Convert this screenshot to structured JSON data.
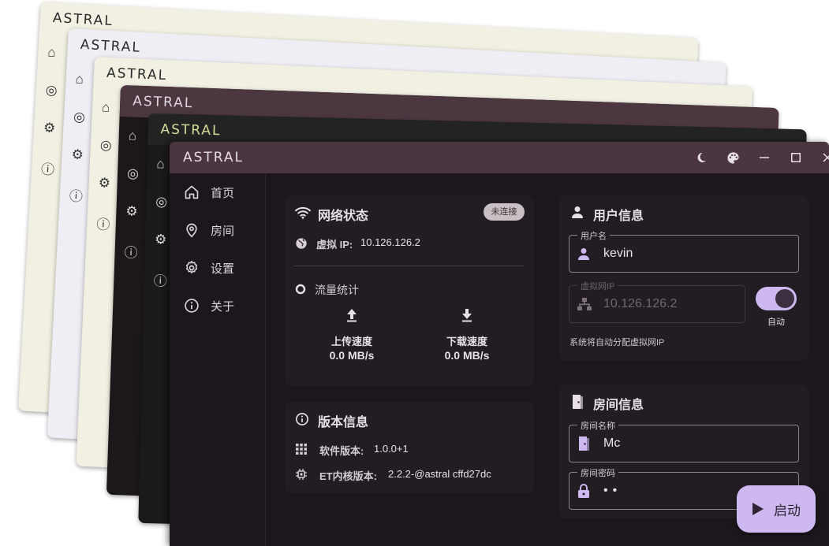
{
  "app_title": "ASTRAL",
  "nav": [
    {
      "label": "首页",
      "icon": "home-icon"
    },
    {
      "label": "房间",
      "icon": "location-pin-icon"
    },
    {
      "label": "设置",
      "icon": "gear-icon"
    },
    {
      "label": "关于",
      "icon": "info-icon"
    }
  ],
  "network": {
    "title": "网络状态",
    "status_badge": "未连接",
    "ip_label": "虚拟 IP:",
    "ip_value": "10.126.126.2"
  },
  "traffic": {
    "title": "流量统计",
    "upload_label": "上传速度",
    "upload_value": "0.0 MB/s",
    "download_label": "下载速度",
    "download_value": "0.0 MB/s"
  },
  "version": {
    "title": "版本信息",
    "software_label": "软件版本:",
    "software_value": "1.0.0+1",
    "core_label": "ET内核版本:",
    "core_value": "2.2.2-@astral cffd27dc"
  },
  "user": {
    "title": "用户信息",
    "username_label": "用户名",
    "username_value": "kevin",
    "vip_label": "虚拟网IP",
    "vip_value": "10.126.126.2",
    "auto_label": "自动",
    "auto_on": true,
    "hint": "系统将自动分配虚拟网IP"
  },
  "room": {
    "title": "房间信息",
    "name_label": "房间名称",
    "name_value": "Mc",
    "password_label": "房间密码",
    "password_value": "••"
  },
  "start_button": "启动",
  "colors": {
    "accent": "#cdb8f0",
    "titlebar": "#4a3540",
    "background": "#1c171d",
    "card": "#221d23"
  }
}
